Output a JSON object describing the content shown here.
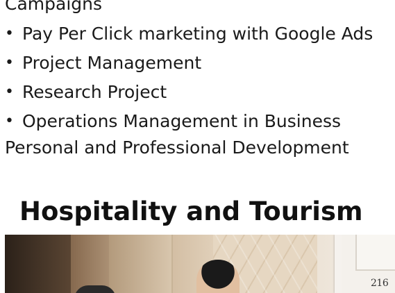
{
  "previous_item_tail": "Campaigns",
  "bullet_items": [
    {
      "label": "Pay Per Click marketing with Google Ads"
    },
    {
      "label": "Project Management"
    },
    {
      "label": "Research Project"
    },
    {
      "label": "Operations Management in Business"
    }
  ],
  "bullet_glyph": "•",
  "plain_line": "Personal and Professional Development",
  "section": {
    "heading": "Hospitality and Tourism",
    "image": {
      "room_number": "216"
    }
  }
}
